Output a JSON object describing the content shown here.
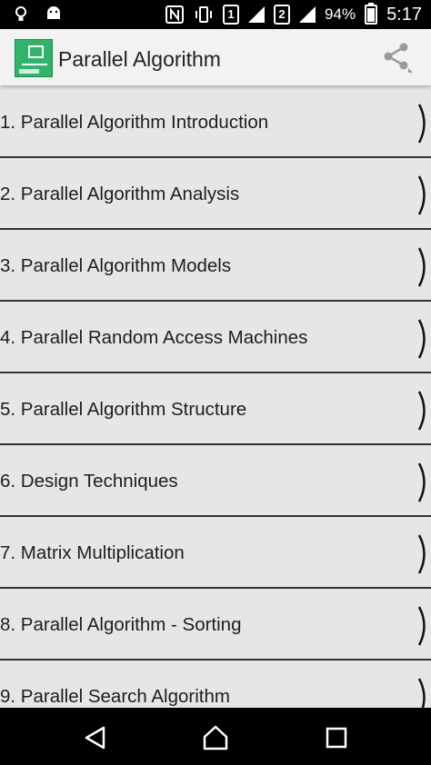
{
  "status_bar": {
    "sim1": "1",
    "sim2": "2",
    "battery": "94%",
    "time": "5:17"
  },
  "app_bar": {
    "title": "Parallel Algorithm",
    "icon_text": "Parallel Algorithm",
    "icon_badge": "TUTORIAL",
    "share_icon": "share-icon"
  },
  "list": {
    "items": [
      {
        "label": "1. Parallel Algorithm Introduction"
      },
      {
        "label": "2. Parallel Algorithm Analysis"
      },
      {
        "label": "3. Parallel Algorithm Models"
      },
      {
        "label": "4. Parallel Random Access Machines"
      },
      {
        "label": "5. Parallel Algorithm Structure"
      },
      {
        "label": "6. Design Techniques"
      },
      {
        "label": "7. Matrix Multiplication"
      },
      {
        "label": "8. Parallel Algorithm - Sorting"
      },
      {
        "label": "9. Parallel Search Algorithm"
      }
    ],
    "chevron_icon": "chevron-right-icon"
  },
  "nav_bar": {
    "back_icon": "back-icon",
    "home_icon": "home-icon",
    "recents_icon": "recents-icon"
  }
}
